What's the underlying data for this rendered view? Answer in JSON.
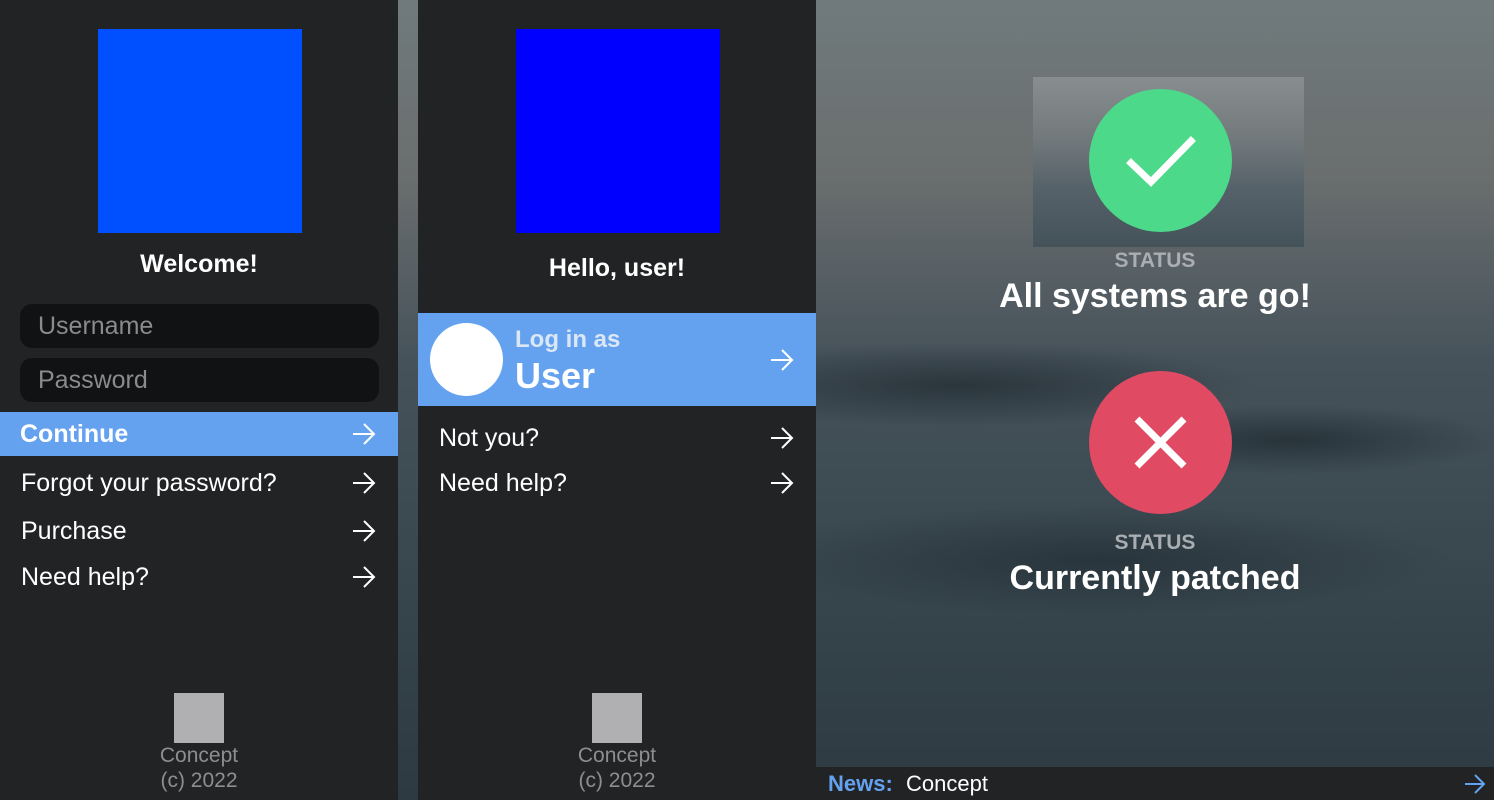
{
  "login_panel": {
    "heading": "Welcome!",
    "username_placeholder": "Username",
    "password_placeholder": "Password",
    "continue_label": "Continue",
    "links": {
      "forgot": "Forgot your password?",
      "purchase": "Purchase",
      "help": "Need help?"
    },
    "footer": {
      "name": "Concept",
      "copyright": "(c) 2022"
    }
  },
  "hello_panel": {
    "heading": "Hello, user!",
    "login_as_small": "Log in as",
    "login_as_user": "User",
    "links": {
      "not_you": "Not you?",
      "help": "Need help?"
    },
    "footer": {
      "name": "Concept",
      "copyright": "(c) 2022"
    }
  },
  "status": {
    "ok": {
      "label": "STATUS",
      "text": "All systems are go!",
      "icon": "check-icon",
      "color": "#4cd98a"
    },
    "error": {
      "label": "STATUS",
      "text": "Currently patched",
      "icon": "x-icon",
      "color": "#e14a63"
    }
  },
  "news": {
    "label": "News:",
    "text": "Concept"
  },
  "colors": {
    "accent": "#64a2f0",
    "panel_bg": "#222325",
    "login_logo": "#0050ff",
    "hello_logo": "#0000ff"
  }
}
